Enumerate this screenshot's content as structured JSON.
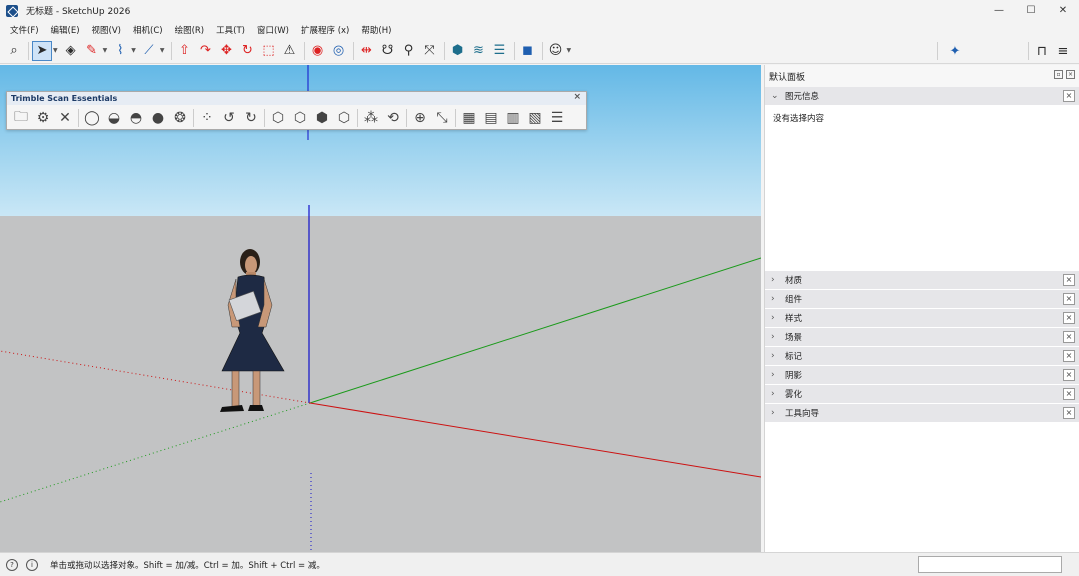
{
  "window": {
    "title": "无标题 - SketchUp 2026",
    "minimize": "—",
    "maximize": "☐",
    "close": "✕"
  },
  "menu": [
    {
      "label": "文件(F)"
    },
    {
      "label": "编辑(E)"
    },
    {
      "label": "视图(V)"
    },
    {
      "label": "相机(C)"
    },
    {
      "label": "绘图(R)"
    },
    {
      "label": "工具(T)"
    },
    {
      "label": "窗口(W)"
    },
    {
      "label": "扩展程序 (x)"
    },
    {
      "label": "帮助(H)"
    }
  ],
  "toolbar": {
    "icons": [
      "search-icon",
      "select-icon",
      "eraser-icon",
      "pencil-icon",
      "freehand-icon",
      "line-icon",
      "push-pull-icon",
      "follow-me-icon",
      "move-icon",
      "rotate-icon",
      "scale-icon",
      "warning-icon",
      "paint-icon",
      "orbit-icon",
      "section-icon",
      "tape-icon",
      "zoom-icon",
      "zoom-extents-icon",
      "warehouse-icon",
      "extension-icon",
      "layers-icon",
      "chat-icon",
      "account-icon"
    ]
  },
  "scan_toolbar": {
    "title": "Trimble Scan Essentials",
    "close": "×"
  },
  "panel": {
    "title": "默认面板",
    "entity_info": {
      "label": "图元信息",
      "empty_text": "没有选择内容"
    },
    "trays": [
      {
        "label": "材质"
      },
      {
        "label": "组件"
      },
      {
        "label": "样式"
      },
      {
        "label": "场景"
      },
      {
        "label": "标记"
      },
      {
        "label": "阴影"
      },
      {
        "label": "雾化"
      },
      {
        "label": "工具向导"
      }
    ]
  },
  "status": {
    "text": "单击或拖动以选择对象。Shift = 加/减。Ctrl = 加。Shift + Ctrl = 减。"
  },
  "colors": {
    "accent": "#4a88c7",
    "red_axis": "#cc1111",
    "green_axis": "#1a9a1a",
    "blue_axis": "#1010cc"
  }
}
